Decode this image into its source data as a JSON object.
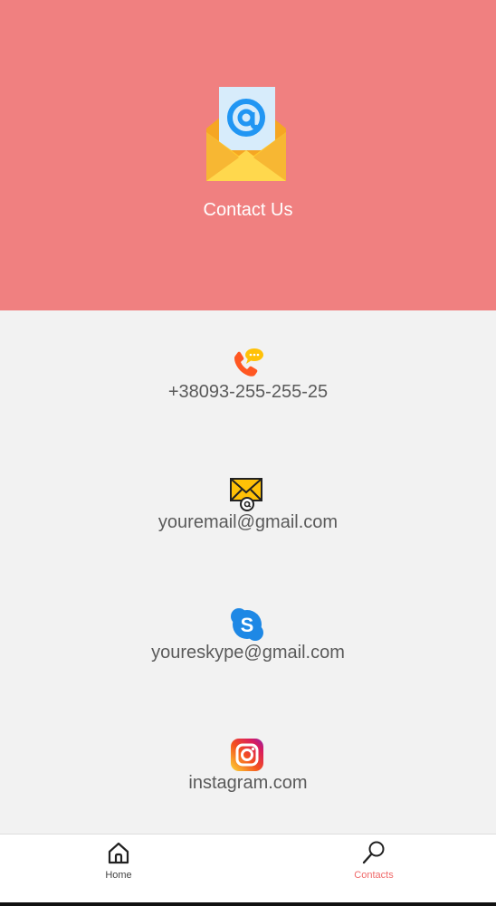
{
  "header": {
    "title": "Contact Us",
    "icon": "email-envelope-icon",
    "background_color": "#f08080"
  },
  "contacts": [
    {
      "icon": "phone-chat-icon",
      "text": "+38093-255-255-25"
    },
    {
      "icon": "mail-at-icon",
      "text": "youremail@gmail.com"
    },
    {
      "icon": "skype-icon",
      "text": "youreskype@gmail.com"
    },
    {
      "icon": "instagram-icon",
      "text": "instagram.com"
    }
  ],
  "bottom_nav": {
    "items": [
      {
        "label": "Home",
        "icon": "home-icon",
        "active": false
      },
      {
        "label": "Contacts",
        "icon": "search-icon",
        "active": true
      }
    ],
    "active_color": "#f06a6a"
  }
}
